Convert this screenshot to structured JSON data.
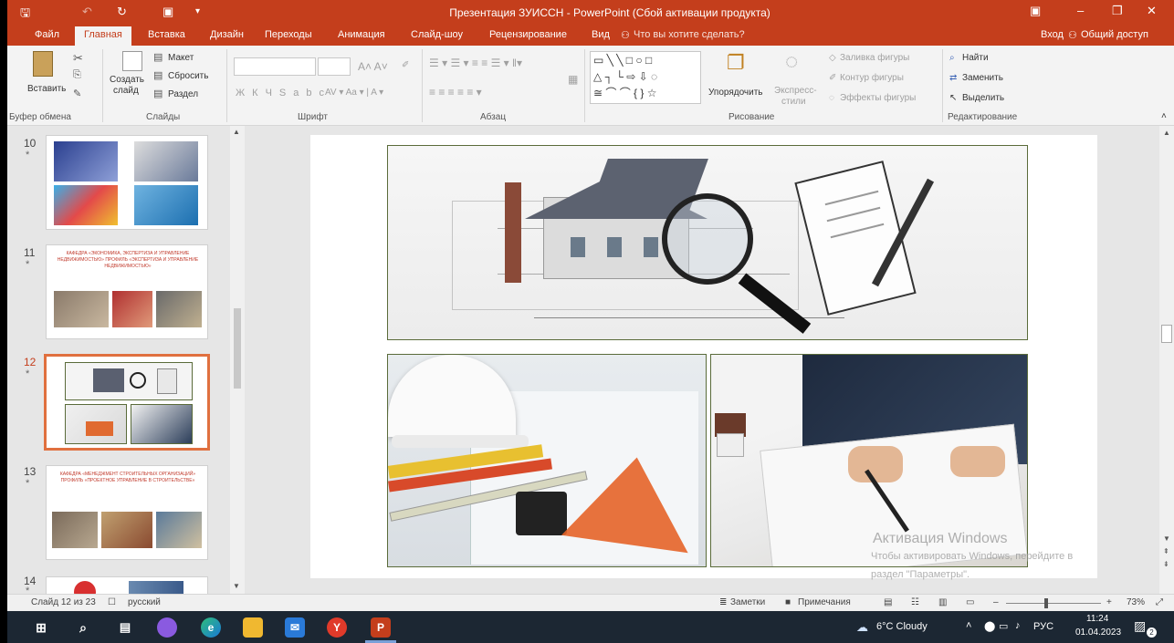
{
  "window": {
    "title": "Презентация ЗУИССН - PowerPoint (Сбой активации продукта)"
  },
  "tabs": [
    {
      "label": "Файл"
    },
    {
      "label": "Главная"
    },
    {
      "label": "Вставка"
    },
    {
      "label": "Дизайн"
    },
    {
      "label": "Переходы"
    },
    {
      "label": "Анимация"
    },
    {
      "label": "Слайд-шоу"
    },
    {
      "label": "Рецензирование"
    },
    {
      "label": "Вид"
    }
  ],
  "tell_me": "Что вы хотите сделать?",
  "account": {
    "signin": "Вход",
    "share": "Общий доступ"
  },
  "ribbon": {
    "paste": "Вставить",
    "clipboard_group": "Буфер обмена",
    "layout": "Макет",
    "reset": "Сбросить",
    "section": "Раздел",
    "new_slide_1": "Создать",
    "new_slide_2": "слайд",
    "slides_group": "Слайды",
    "font_group": "Шрифт",
    "paragraph_group": "Абзац",
    "arrange": "Упорядочить",
    "quick_styles_1": "Экспресс-",
    "quick_styles_2": "стили",
    "shape_fill": "Заливка фигуры",
    "shape_outline": "Контур фигуры",
    "shape_effects": "Эффекты фигуры",
    "drawing_group": "Рисование",
    "find": "Найти",
    "replace": "Заменить",
    "select": "Выделить",
    "editing_group": "Редактирование"
  },
  "slides": [
    {
      "number": "10",
      "star": "*"
    },
    {
      "number": "11",
      "star": "*",
      "text": "КАФЕДРА «ЭКОНОМИКА, ЭКСПЕРТИЗА И УПРАВЛЕНИЕ НЕДВИЖИМОСТЬЮ» ПРОФИЛЬ «ЭКСПЕРТИЗА И УПРАВЛЕНИЕ НЕДВИЖИМОСТЬЮ»"
    },
    {
      "number": "12",
      "star": "*"
    },
    {
      "number": "13",
      "star": "*",
      "text": "КАФЕДРА «МЕНЕДЖМЕНТ СТРОИТЕЛЬНЫХ ОРГАНИЗАЦИЙ» ПРОФИЛЬ «ПРОЕКТНОЕ УПРАВЛЕНИЕ В СТРОИТЕЛЬСТВЕ»"
    },
    {
      "number": "14",
      "star": "*"
    }
  ],
  "watermark": {
    "line1": "Активация Windows",
    "line2": "Чтобы активировать Windows, перейдите в",
    "line3": "раздел \"Параметры\"."
  },
  "status": {
    "slide_counter": "Слайд 12 из 23",
    "language": "русский",
    "notes": "Заметки",
    "comments": "Примечания",
    "zoom": "73%"
  },
  "taskbar": {
    "weather": "6°C  Cloudy",
    "lang": "РУС",
    "time": "11:24",
    "date": "01.04.2023",
    "notif_count": "2"
  },
  "colors": {
    "accent": "#c43e1c",
    "thumb_selected": "#e0703f",
    "taskbar": "#1c2733"
  },
  "icons": [
    "save-icon",
    "undo-icon",
    "redo-icon",
    "customize-icon",
    "search-icon",
    "lightbulb-icon",
    "user-icon",
    "paste-icon",
    "windows-start-icon",
    "edge-icon",
    "folder-icon",
    "mail-icon",
    "yandex-icon",
    "powerpoint-icon"
  ]
}
